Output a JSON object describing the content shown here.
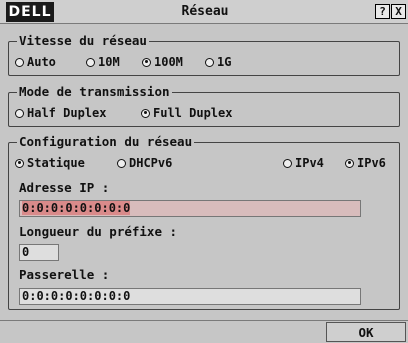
{
  "window": {
    "title": "Réseau",
    "logo_text": "DELL",
    "help_label": "?",
    "close_label": "X"
  },
  "vitesse": {
    "legend": "Vitesse du réseau",
    "options": [
      {
        "label": "Auto",
        "selected": false
      },
      {
        "label": "10M",
        "selected": false
      },
      {
        "label": "100M",
        "selected": true
      },
      {
        "label": "1G",
        "selected": false
      }
    ]
  },
  "mode": {
    "legend": "Mode de transmission",
    "options": [
      {
        "label": "Half Duplex",
        "selected": false
      },
      {
        "label": "Full Duplex",
        "selected": true
      }
    ]
  },
  "config": {
    "legend": "Configuration du réseau",
    "options": [
      {
        "label": "Statique",
        "selected": true
      },
      {
        "label": "DHCPv6",
        "selected": false
      },
      {
        "label": "IPv4",
        "selected": false
      },
      {
        "label": "IPv6",
        "selected": true
      }
    ],
    "ip_label": "Adresse IP :",
    "ip_value": "0:0:0:0:0:0:0:0",
    "prefix_label": "Longueur du préfixe :",
    "prefix_value": "0",
    "gateway_label": "Passerelle :",
    "gateway_value": "0:0:0:0:0:0:0:0"
  },
  "ok_label": "OK"
}
